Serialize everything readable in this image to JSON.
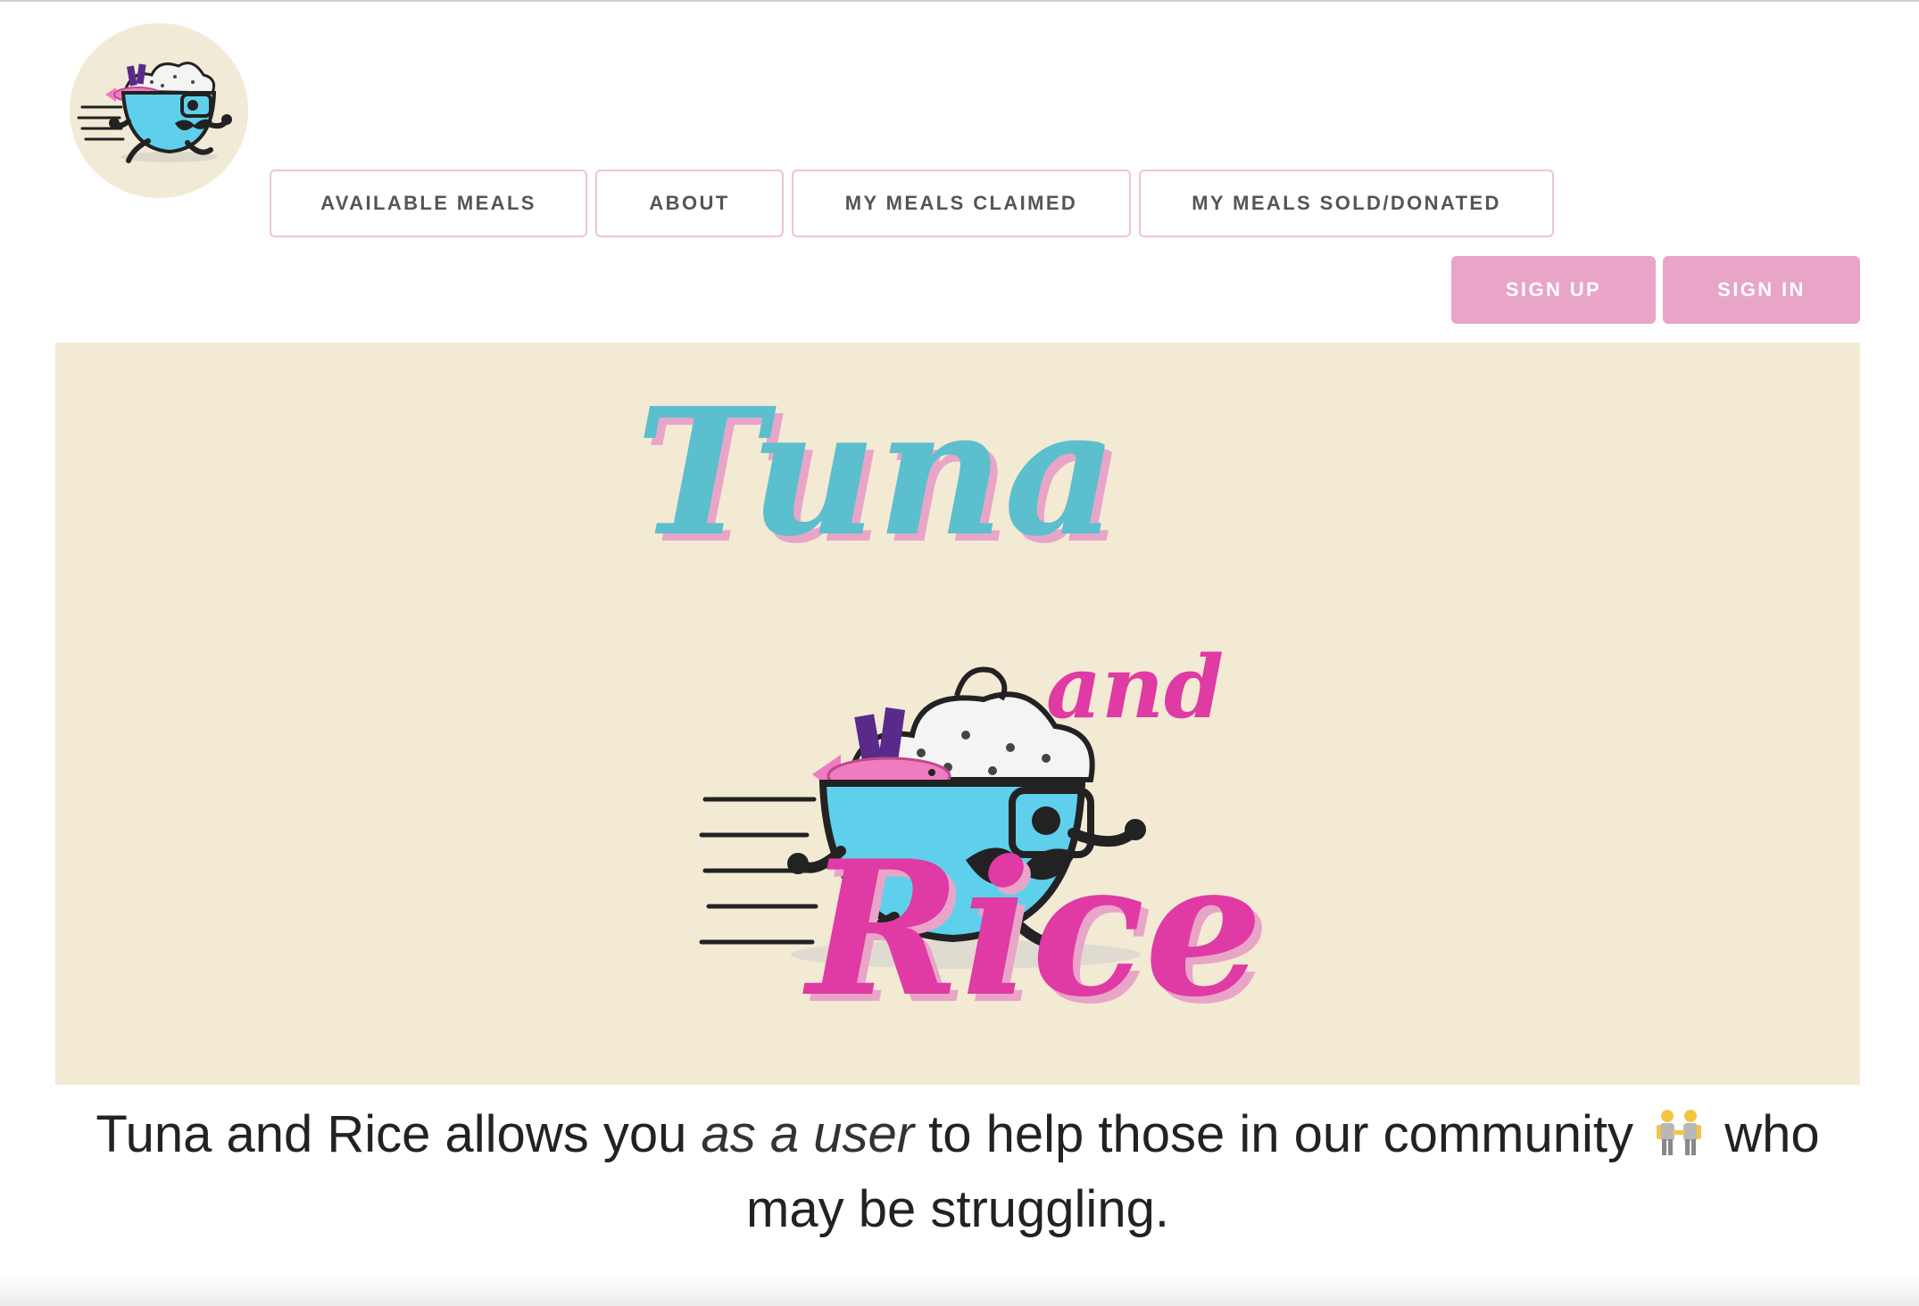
{
  "brand": {
    "hero_word_top": "Tuna",
    "hero_word_mid": "and",
    "hero_word_bottom": "Rice",
    "icon": "running-rice-bowl-mascot-icon"
  },
  "nav": {
    "items": [
      {
        "label": "AVAILABLE MEALS"
      },
      {
        "label": "ABOUT"
      },
      {
        "label": "MY MEALS CLAIMED"
      },
      {
        "label": "MY MEALS SOLD/DONATED"
      }
    ]
  },
  "auth": {
    "signup_label": "SIGN UP",
    "signin_label": "SIGN IN"
  },
  "tagline": {
    "part1": "Tuna and Rice allows you ",
    "emphasis": "as a user",
    "part2": " to help those in our community ",
    "emoji": "two-people-holding-hands-icon",
    "part3": " who may be struggling."
  },
  "colors": {
    "accent_pink": "#e8a5c8",
    "nav_border": "#efc3d6",
    "hero_background": "#f3ead4",
    "brand_teal": "#5bbfcd",
    "brand_magenta": "#e03aa4"
  }
}
